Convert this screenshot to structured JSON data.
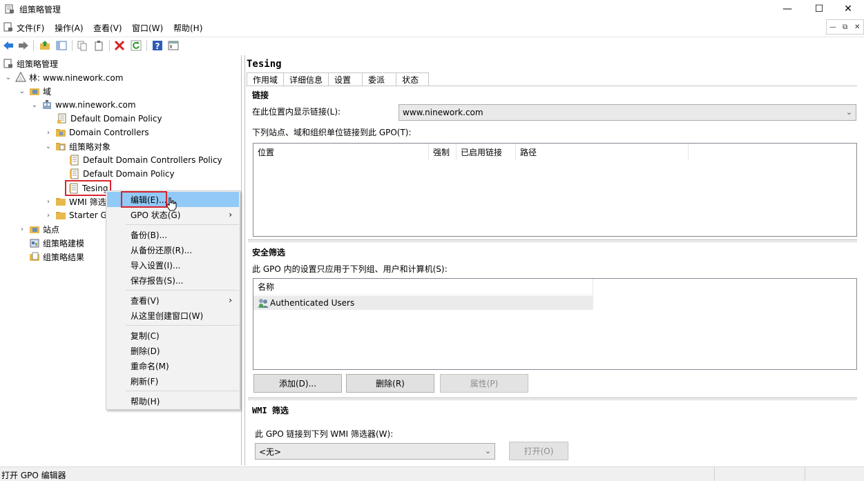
{
  "window": {
    "title": "组策略管理",
    "min_glyph": "—",
    "max_glyph": "☐",
    "close_glyph": "✕"
  },
  "menu": {
    "file": "文件(F)",
    "action": "操作(A)",
    "view": "查看(V)",
    "window": "窗口(W)",
    "help": "帮助(H)"
  },
  "mdi": {
    "min": "—",
    "restore": "⧉",
    "close": "✕"
  },
  "tree": {
    "root": "组策略管理",
    "forest": "林: www.ninework.com",
    "domains": "域",
    "domain": "www.ninework.com",
    "default_domain_policy": "Default Domain Policy",
    "domain_controllers": "Domain Controllers",
    "gpo_container": "组策略对象",
    "gpo_ddcp": "Default Domain Controllers Policy",
    "gpo_ddp": "Default Domain Policy",
    "gpo_tesing": "Tesing",
    "wmi_filters": "WMI 筛选",
    "starter_gpos": "Starter G",
    "sites": "站点",
    "modeling": "组策略建模",
    "results": "组策略结果"
  },
  "context_menu": {
    "edit": "编辑(E)...",
    "gpo_status": "GPO 状态(G)",
    "backup": "备份(B)...",
    "restore": "从备份还原(R)...",
    "import": "导入设置(I)...",
    "save_report": "保存报告(S)...",
    "view": "查看(V)",
    "new_window": "从这里创建窗口(W)",
    "copy": "复制(C)",
    "delete": "删除(D)",
    "rename": "重命名(M)",
    "refresh": "刷新(F)",
    "help": "帮助(H)"
  },
  "details": {
    "gpo_name": "Tesing",
    "tabs": [
      "作用域",
      "详细信息",
      "设置",
      "委派",
      "状态"
    ],
    "links": {
      "heading": "链接",
      "location_label": "在此位置内显示链接(L):",
      "location_value": "www.ninework.com",
      "linked_label": "下列站点、域和组织单位链接到此 GPO(T):",
      "columns": [
        "位置",
        "强制",
        "已启用链接",
        "路径"
      ]
    },
    "security": {
      "heading": "安全筛选",
      "applies_label": "此 GPO 内的设置只应用于下列组、用户和计算机(S):",
      "column": "名称",
      "entries": [
        "Authenticated Users"
      ],
      "add": "添加(D)...",
      "remove": "删除(R)",
      "properties": "属性(P)"
    },
    "wmi": {
      "heading": "WMI 筛选",
      "label": "此 GPO 链接到下列 WMI 筛选器(W):",
      "value": "<无>",
      "open": "打开(O)"
    }
  },
  "status": {
    "text": "打开 GPO 编辑器"
  },
  "colors": {
    "highlight_red": "#d9232e",
    "menu_highlight": "#91c9f7",
    "folder_yellow": "#e8b94a"
  }
}
